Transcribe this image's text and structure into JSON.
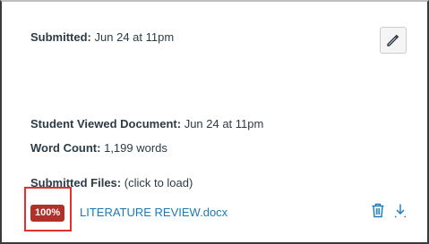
{
  "submitted": {
    "label": "Submitted:",
    "value": "Jun 24 at 11pm"
  },
  "viewed": {
    "label": "Student Viewed Document:",
    "value": "Jun 24 at 11pm"
  },
  "word_count": {
    "label": "Word Count:",
    "value": "1,199 words"
  },
  "files": {
    "label": "Submitted Files:",
    "hint": "(click to load)",
    "items": [
      {
        "badge": "100%",
        "name": "LITERATURE REVIEW.docx"
      }
    ]
  },
  "icons": {
    "edit": "pencil-icon",
    "delete": "trash-icon",
    "download": "download-icon"
  },
  "colors": {
    "badge": "#b0302a",
    "link": "#1a7ab8",
    "highlight": "#e0312e"
  }
}
